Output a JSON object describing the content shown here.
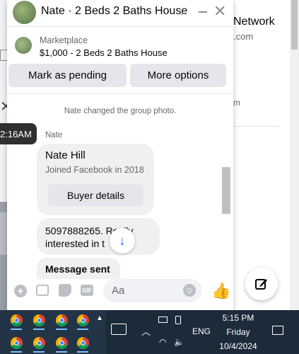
{
  "background": {
    "title_fragment": "Network",
    "sub_fragment": ".com",
    "fragment_m": "m"
  },
  "header": {
    "title": "Nate · 2 Beds 2 Baths House",
    "chevron_icon": "chevron-down-icon",
    "minimize_icon": "minimize-icon",
    "close_icon": "close-icon"
  },
  "marketplace": {
    "label": "Marketplace",
    "listing": "$1,000 - 2 Beds 2 Baths House"
  },
  "actions": {
    "pending_label": "Mark as pending",
    "more_label": "More options"
  },
  "conversation": {
    "system_message": "Nate changed the group photo.",
    "sender": "Nate",
    "profile_card": {
      "name": "Nate Hill",
      "joined": "Joined Facebook in 2018",
      "button": "Buyer details"
    },
    "message1": "5097888265. Really interested in t",
    "message2": "Message sent"
  },
  "tooltip": {
    "time": "2:16AM"
  },
  "composer": {
    "placeholder": "Aa",
    "icons": [
      "plus-icon",
      "photo-icon",
      "sticker-icon",
      "gif-icon",
      "emoji-icon",
      "like-icon"
    ]
  },
  "taskbar": {
    "language": "ENG",
    "time": "5:15 PM",
    "day": "Friday",
    "date": "10/4/2024"
  },
  "colors": {
    "accent": "#0866ff",
    "taskbar": "#1c2b3a",
    "bubble": "#f0f0f0"
  }
}
